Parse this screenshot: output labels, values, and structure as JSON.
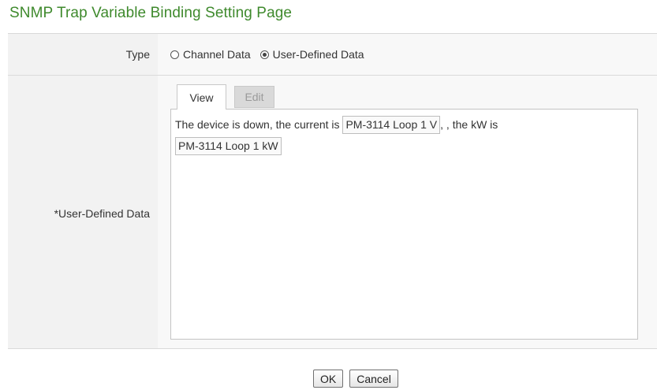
{
  "page": {
    "title": "SNMP Trap Variable Binding Setting Page"
  },
  "type_row": {
    "label": "Type",
    "options": [
      {
        "label": "Channel Data",
        "selected": false
      },
      {
        "label": "User-Defined Data",
        "selected": true
      }
    ]
  },
  "data_row": {
    "label": "*User-Defined Data",
    "tabs": [
      {
        "label": "View",
        "active": true
      },
      {
        "label": "Edit",
        "active": false
      }
    ],
    "content": {
      "text_1": "The device is down, the current is ",
      "token_1": "PM-3114 Loop 1 V",
      "text_2": ", , the kW is",
      "token_2": "PM-3114 Loop 1 kW"
    }
  },
  "buttons": {
    "ok": "OK",
    "cancel": "Cancel"
  },
  "colors": {
    "title_green": "#3f8a2d",
    "label_bg": "#f2f2f2",
    "value_bg": "#f8f8f8"
  }
}
